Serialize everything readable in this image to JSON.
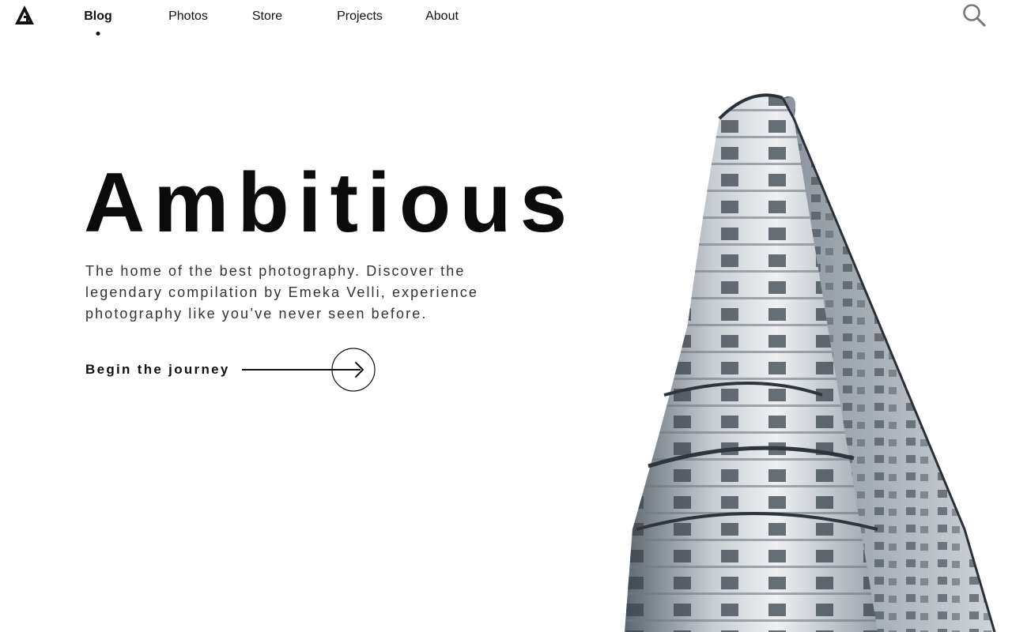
{
  "brand": {
    "logo_icon": "triangle-a-logo-icon"
  },
  "nav": {
    "items": [
      {
        "label": "Blog",
        "active": true
      },
      {
        "label": "Photos",
        "active": false
      },
      {
        "label": "Store",
        "active": false
      },
      {
        "label": "Projects",
        "active": false
      },
      {
        "label": "About",
        "active": false
      }
    ],
    "search_icon": "search-icon"
  },
  "hero": {
    "title": "Ambitious",
    "description": "The home of the best photography. Discover the legendary compilation by Emeka Velli, experience photography like you’ve never seen before.",
    "cta_label": "Begin the journey",
    "cta_icon": "arrow-right-circle-icon"
  },
  "image": {
    "subject": "building-photo"
  },
  "colors": {
    "text": "#111111",
    "background": "#ffffff",
    "muted": "#333333"
  }
}
